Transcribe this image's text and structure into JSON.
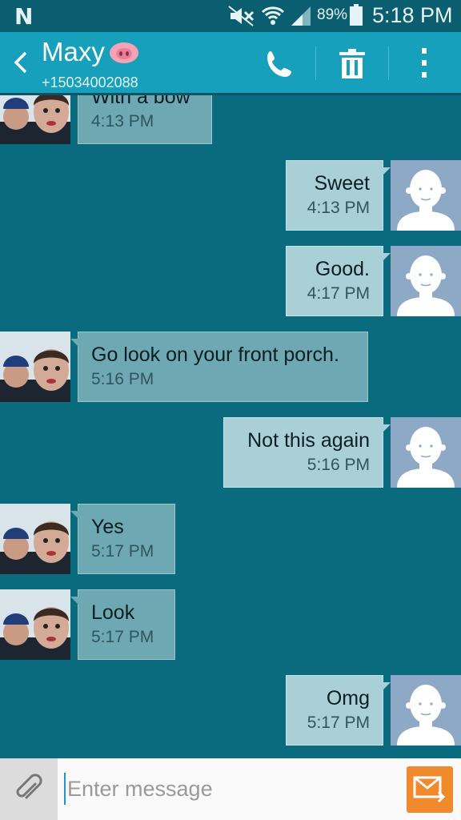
{
  "status_bar": {
    "battery_percent": "89%",
    "time": "5:18 PM"
  },
  "header": {
    "contact_name": "Maxy",
    "phone_number": "+15034002088"
  },
  "messages": [
    {
      "direction": "in",
      "text": "With a bow",
      "time": "4:13 PM"
    },
    {
      "direction": "out",
      "text": "Sweet",
      "time": "4:13 PM"
    },
    {
      "direction": "out",
      "text": "Good.",
      "time": "4:17 PM"
    },
    {
      "direction": "in",
      "text": "Go look on your front porch.",
      "time": "5:16 PM"
    },
    {
      "direction": "out",
      "text": "Not this again",
      "time": "5:16 PM"
    },
    {
      "direction": "in",
      "text": "Yes",
      "time": "5:17 PM"
    },
    {
      "direction": "in",
      "text": "Look",
      "time": "5:17 PM"
    },
    {
      "direction": "out",
      "text": "Omg",
      "time": "5:17 PM"
    }
  ],
  "compose": {
    "placeholder": "Enter message"
  },
  "colors": {
    "background": "#0a6a7e",
    "action_bar": "#17a0bb",
    "incoming_bubble": "#6ea8b3",
    "outgoing_bubble": "#a8d0d6",
    "send_button": "#f08a2c"
  }
}
